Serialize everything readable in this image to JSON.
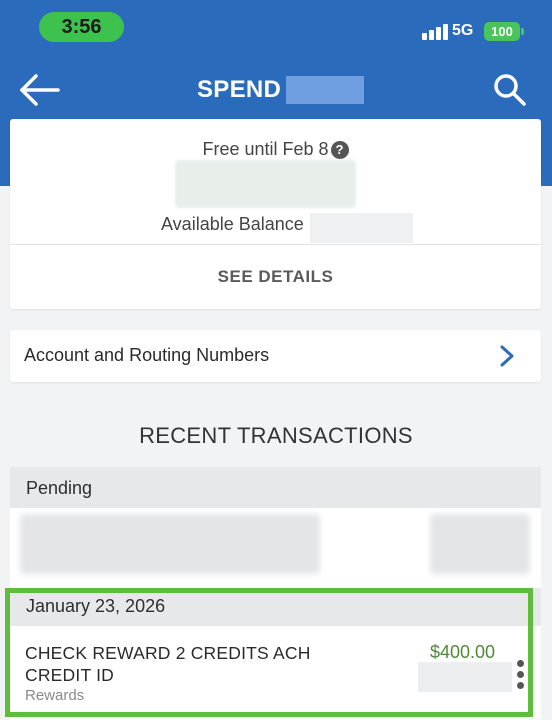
{
  "status_bar": {
    "time": "3:56",
    "network": "5G",
    "battery": "100"
  },
  "nav": {
    "title": "SPEND",
    "back_icon": "arrow-left-icon",
    "search_icon": "search-icon"
  },
  "balance_card": {
    "free_until": "Free until Feb 8",
    "help_icon": "?",
    "available_balance_label": "Available Balance",
    "see_details": "SEE DETAILS"
  },
  "account_row": {
    "label": "Account and Routing Numbers",
    "icon": "chevron-right-icon"
  },
  "recent_title": "RECENT TRANSACTIONS",
  "transactions": {
    "pending_label": "Pending",
    "groups": [
      {
        "date": "January 23, 2026",
        "items": [
          {
            "description": "CHECK REWARD 2 CREDITS ACH CREDIT ID",
            "category": "Rewards",
            "amount": "$400.00"
          }
        ]
      }
    ]
  },
  "colors": {
    "header_blue": "#2b6bbb",
    "amount_green": "#4e8a36",
    "highlight_green": "#5fbd3e",
    "time_pill_green": "#3ec24e"
  }
}
